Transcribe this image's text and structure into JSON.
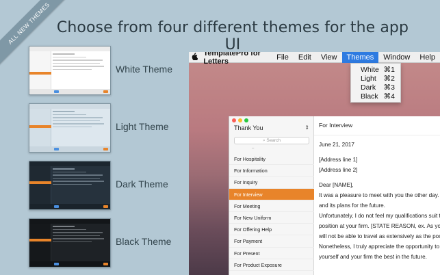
{
  "badge": "ALL NEW THEMES",
  "headline": "Choose from four different themes for the app UI",
  "themes": [
    {
      "label": "White Theme"
    },
    {
      "label": "Light Theme"
    },
    {
      "label": "Dark Theme"
    },
    {
      "label": "Black Theme"
    }
  ],
  "menubar": {
    "app_name": "TemplatePro for Letters",
    "items": [
      "File",
      "Edit",
      "View",
      "Themes",
      "Window",
      "Help"
    ],
    "active": "Themes"
  },
  "themes_menu": [
    {
      "label": "White",
      "shortcut": "⌘1"
    },
    {
      "label": "Light",
      "shortcut": "⌘2"
    },
    {
      "label": "Dark",
      "shortcut": "⌘3"
    },
    {
      "label": "Black",
      "shortcut": "⌘4"
    }
  ],
  "sidebar": {
    "title": "Thank You",
    "search_placeholder": "Search",
    "items": [
      "For Hospitality",
      "For Information",
      "For Inquiry",
      "For Interview",
      "For Meeting",
      "For New Uniform",
      "For Offering Help",
      "For Payment",
      "For Present",
      "For Product Exposure"
    ],
    "selected": "For Interview"
  },
  "document": {
    "title": "For Interview",
    "lines": [
      "June 21, 2017",
      "",
      "[Address line 1]",
      "[Address line 2]",
      "",
      "Dear [NAME],",
      "It was a pleasure to meet with you the other day. I w",
      "and its plans for the future.",
      "Unfortunately, I do not feel my qualifications suit the",
      "position at your firm. [STATE REASON, ex. As you have",
      "will not be able to travel as extensively as the positi",
      "Nonetheless, I truly appreciate the opportunity to h",
      "yourself and your firm the best in the future."
    ]
  },
  "colors": {
    "accent": "#e8842a",
    "menu_highlight": "#2e7be1",
    "background": "#b3c8d4"
  }
}
